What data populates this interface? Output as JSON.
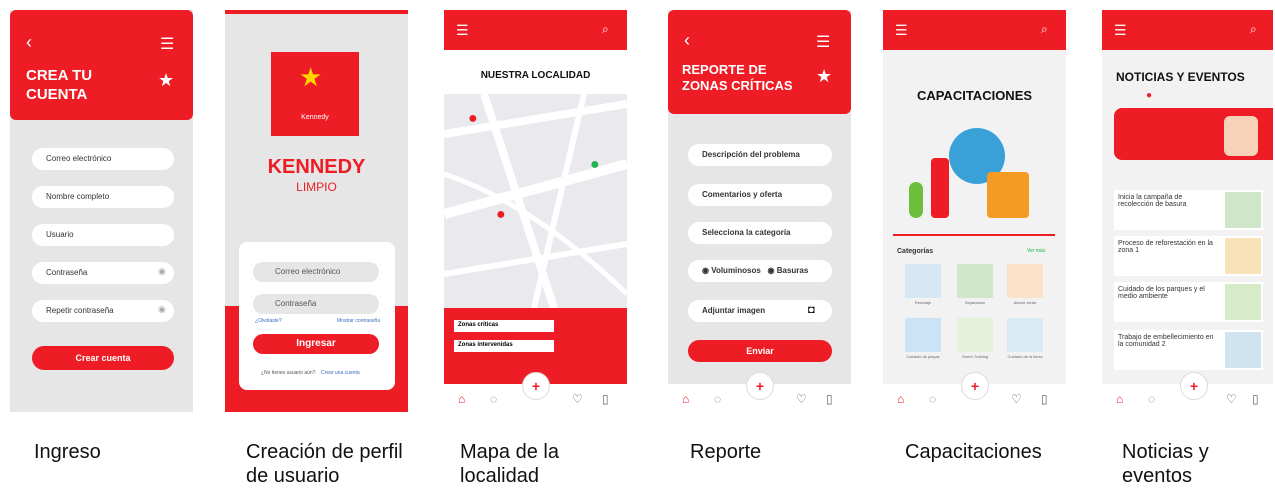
{
  "captions": [
    "Ingreso",
    "Creación de perfil de usuario",
    "Mapa de la localidad",
    "Reporte",
    "Capacitaciones",
    "Noticias y eventos"
  ],
  "screen1": {
    "title": "CREA TU CUENTA",
    "fields": [
      "Correo electrónico",
      "Nombre completo",
      "Usuario",
      "Contraseña",
      "Repetir contraseña"
    ],
    "button": "Crear cuenta"
  },
  "screen2": {
    "brand": "KENNEDY",
    "brand_sub": "LIMPIO",
    "logo_text": "Kennedy",
    "email_placeholder": "Correo electrónico",
    "password_placeholder": "Contraseña",
    "forgot": "¿Olvidaste?",
    "remember": "Mostrar contraseña",
    "login_button": "Ingresar",
    "no_account": "¿No tienes usuario aún?",
    "register_link": "Crear una cuenta"
  },
  "screen3": {
    "title": "NUESTRA LOCALIDAD",
    "legend": [
      "Zonas críticas",
      "Zonas intervenidas"
    ]
  },
  "screen4": {
    "title": "REPORTE DE ZONAS CRÍTICAS",
    "fields": [
      "Descripción del problema",
      "Comentarios y oferta",
      "Selecciona la categoría"
    ],
    "radios": [
      "Voluminosos",
      "Basuras"
    ],
    "attach": "Adjuntar imagen",
    "submit": "Enviar"
  },
  "screen5": {
    "title": "CAPACITACIONES",
    "categories_label": "Categorías",
    "see_all": "Ver más",
    "items": [
      "Reciclaje",
      "Separación",
      "Abono verde",
      "Cuidado de playas",
      "Green Training",
      "Cuidado de la tierra"
    ]
  },
  "screen6": {
    "title": "NOTICIAS Y EVENTOS",
    "news": [
      "Inicia la campaña de recolección de basura",
      "Proceso de reforestación en la zona 1",
      "Cuidado de los parques y el medio ambiente",
      "Trabajo de embellecimiento en la comunidad 2"
    ]
  },
  "colors": {
    "brand_red": "#ee1c25",
    "background": "#e8e8e8",
    "pin_green": "#21b24b"
  },
  "icons": [
    "back-arrow-icon",
    "hamburger-icon",
    "search-icon",
    "home-icon",
    "chat-icon",
    "plus-icon",
    "heart-icon",
    "bookmark-icon",
    "eye-icon",
    "camera-icon",
    "location-pin-icon"
  ]
}
